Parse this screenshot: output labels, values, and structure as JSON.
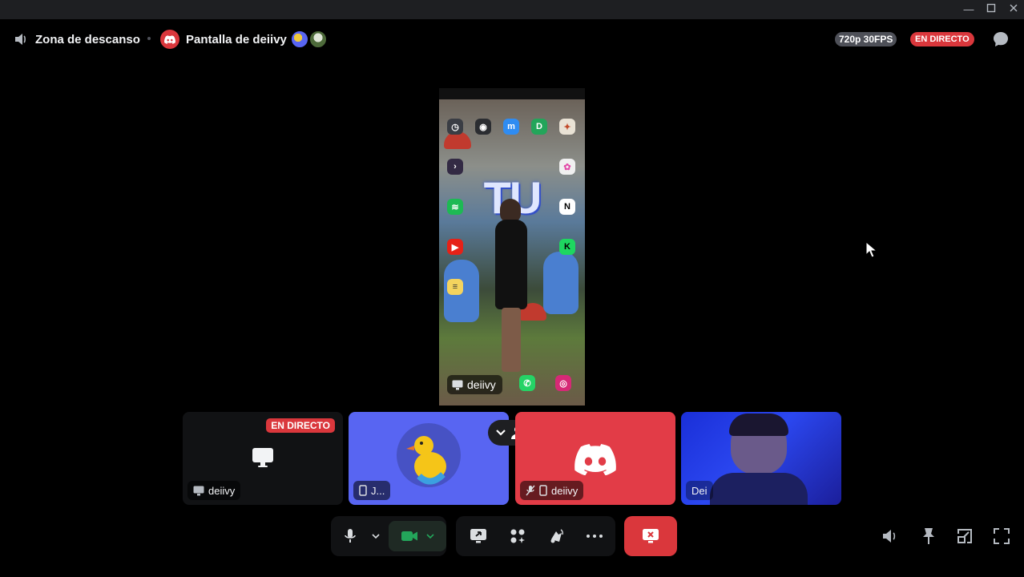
{
  "header": {
    "voice_channel": "Zona de descanso",
    "stream_title": "Pantalla de deiivy",
    "quality": "720p 30FPS",
    "live_badge": "EN DIRECTO"
  },
  "stage": {
    "streamer_label": "deiivy",
    "wallpaper_sign": "TU"
  },
  "participants": [
    {
      "name": "deiivy",
      "kind": "stream",
      "live_badge": "EN DIRECTO"
    },
    {
      "name": "J...",
      "kind": "avatar"
    },
    {
      "name": "deiivy",
      "kind": "discord-avatar"
    },
    {
      "name": "Dei",
      "kind": "camera"
    }
  ],
  "colors": {
    "accent_red": "#da373c",
    "tile_blue": "#5865f2",
    "tile_red": "#e23c47",
    "active_green": "#23a55a"
  }
}
